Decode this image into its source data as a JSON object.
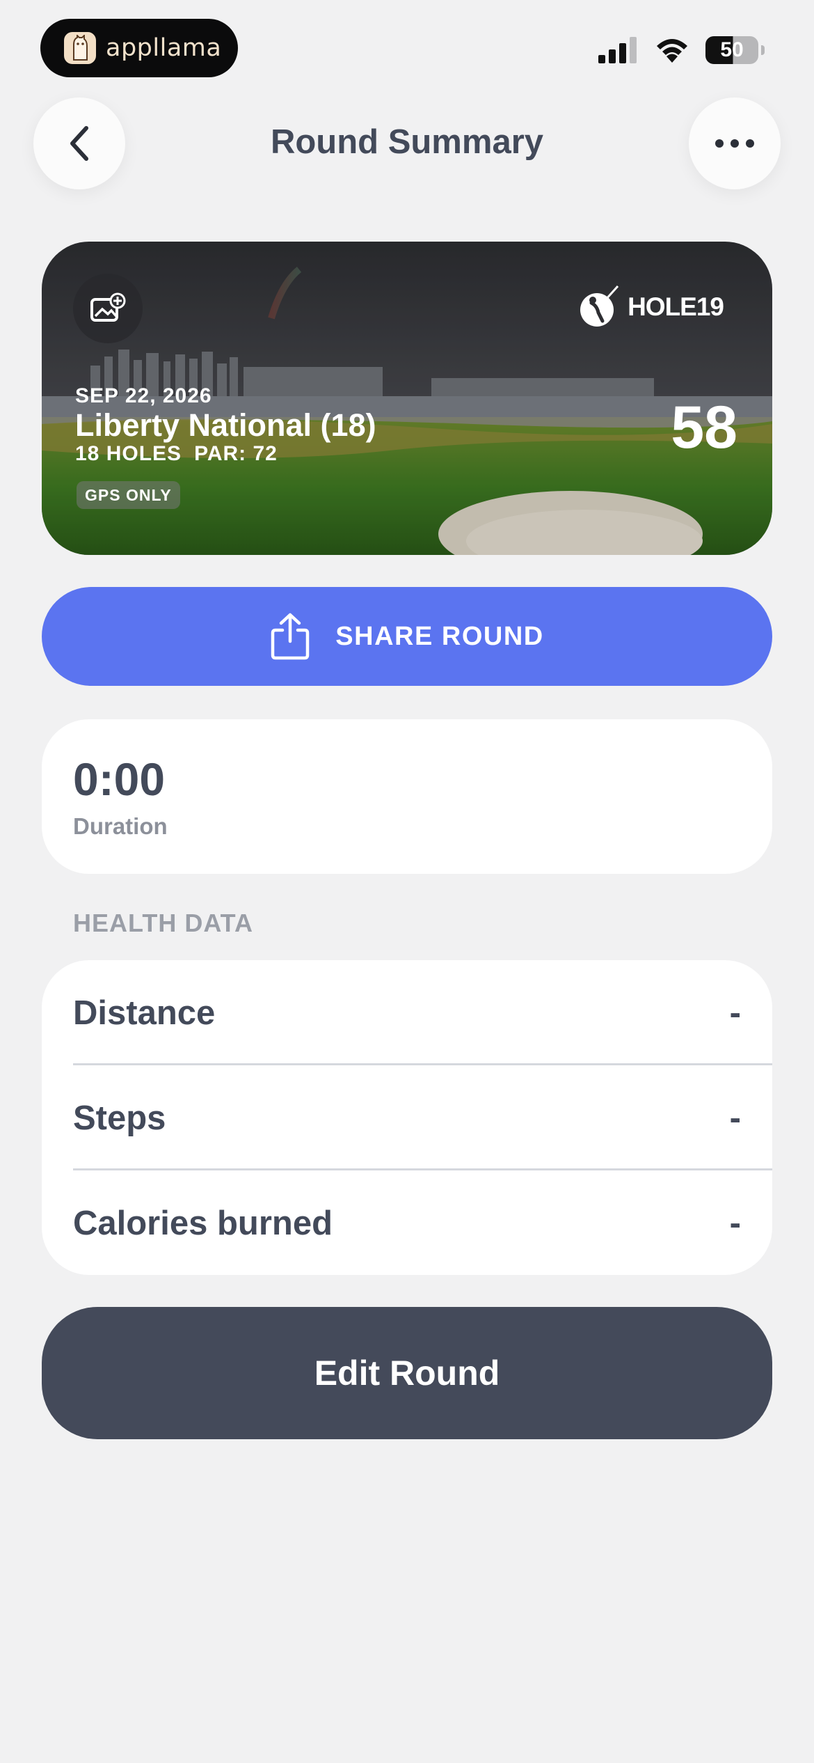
{
  "status_bar": {
    "app_badge": "appllama",
    "battery": "50"
  },
  "nav": {
    "title": "Round Summary"
  },
  "hero": {
    "brand": "HOLE19",
    "date": "SEP 22, 2026",
    "course": "Liberty National (18)",
    "holes": "18 HOLES",
    "par": "PAR: 72",
    "mode_badge": "GPS ONLY",
    "score": "58"
  },
  "share": {
    "label": "SHARE ROUND"
  },
  "duration": {
    "value": "0:00",
    "label": "Duration"
  },
  "health": {
    "header": "HEALTH DATA",
    "rows": [
      {
        "label": "Distance",
        "value": "-"
      },
      {
        "label": "Steps",
        "value": "-"
      },
      {
        "label": "Calories burned",
        "value": "-"
      }
    ]
  },
  "edit": {
    "label": "Edit Round"
  },
  "colors": {
    "accent": "#5b74f0",
    "dark_button": "#444a5a",
    "text": "#434a5a",
    "muted": "#8c909a",
    "background": "#f1f1f2"
  }
}
